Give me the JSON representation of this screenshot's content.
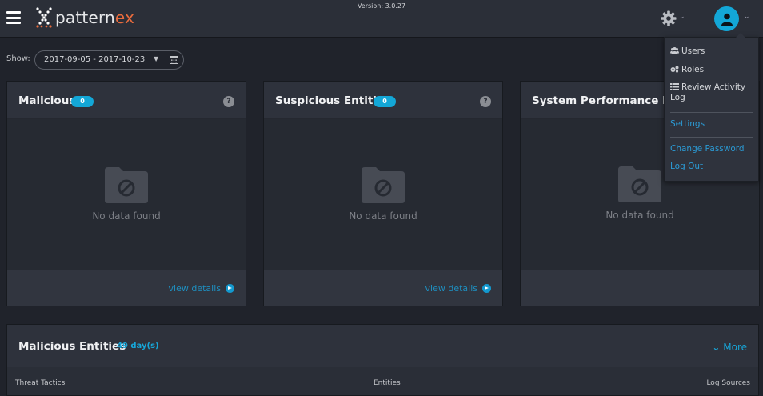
{
  "header": {
    "logo_prefix": "pattern",
    "logo_suffix": "ex",
    "version": "Version: 3.0.27",
    "icons": [
      "hamburger-icon",
      "logo-x-icon",
      "gear-icon",
      "user-icon",
      "chevron-down-icon"
    ]
  },
  "filter": {
    "show_label": "Show:",
    "date_range": "2017-09-05 - 2017-10-23"
  },
  "cards": [
    {
      "title": "Malicious",
      "badge": "0",
      "help": "?",
      "empty_text": "No data found",
      "link": "view details"
    },
    {
      "title": "Suspicious Entities",
      "badge": "0",
      "help": "?",
      "empty_text": "No data found",
      "link": "view details"
    },
    {
      "title": "System Performance Report",
      "empty_text": "No data found"
    }
  ],
  "entities": {
    "title": "Malicious Entities",
    "days": "49 day(s)",
    "more_label": "More",
    "columns": [
      "Threat Tactics",
      "Entities",
      "Log Sources"
    ]
  },
  "user_menu": {
    "users": "Users",
    "roles": "Roles",
    "review_activity_line1": "Review Activity",
    "review_activity_line2": "Log",
    "settings": "Settings",
    "change_password": "Change Password",
    "log_out": "Log Out"
  },
  "colors": {
    "accent": "#13a7d7",
    "brand_orange": "#e86b3d",
    "background": "#20232b",
    "panel": "#2a2e37",
    "link": "#2b9ad4"
  }
}
